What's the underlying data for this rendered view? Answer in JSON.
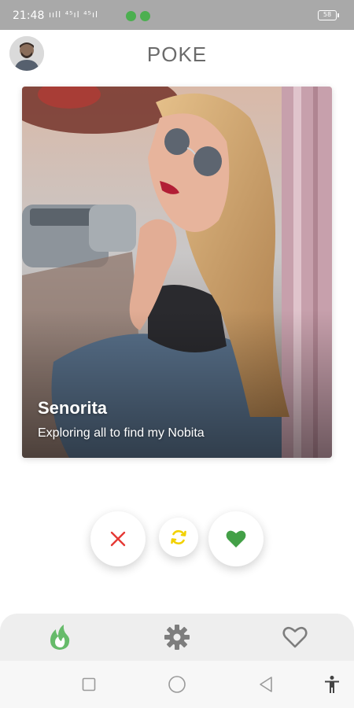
{
  "status_bar": {
    "time": "21:48",
    "signal_text": "ııll ⁴⁵ıl ⁴⁵ıl",
    "battery": "58"
  },
  "header": {
    "title": "POKE",
    "avatar_icon": "user-avatar"
  },
  "card": {
    "name": "Senorita",
    "bio": "Exploring all to find my Nobita",
    "photo_icon": "profile-photo"
  },
  "actions": {
    "nope_icon": "close-icon",
    "rewind_icon": "refresh-icon",
    "like_icon": "heart-icon",
    "nope_color": "#e53935",
    "rewind_color": "#f2d100",
    "like_color": "#43a047"
  },
  "bottom_nav": {
    "items": [
      {
        "icon": "flame-icon",
        "active": true,
        "color": "#66bb6a"
      },
      {
        "icon": "gear-icon",
        "active": false,
        "color": "#7d7d7d"
      },
      {
        "icon": "heart-outline-icon",
        "active": false,
        "color": "#7d7d7d"
      }
    ]
  },
  "system_nav": {
    "items": [
      "recent-apps-icon",
      "home-icon",
      "back-icon",
      "accessibility-icon"
    ]
  }
}
